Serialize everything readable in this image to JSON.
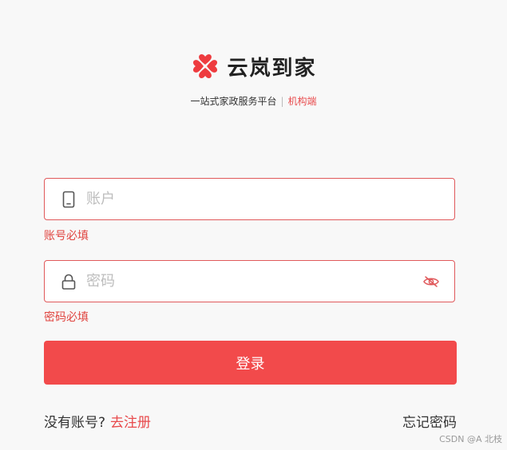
{
  "brand": {
    "name": "云岚到家",
    "logo_icon": "clover-heart-logo",
    "accent_color": "#f24a4b"
  },
  "tagline": {
    "text": "一站式家政服务平台",
    "separator": "|",
    "role": "机构端"
  },
  "form": {
    "account": {
      "icon": "phone-icon",
      "placeholder": "账户",
      "value": "",
      "error": "账号必填"
    },
    "password": {
      "icon": "lock-icon",
      "placeholder": "密码",
      "value": "",
      "error": "密码必填",
      "toggle_icon": "eye-off-icon"
    },
    "login_label": "登录"
  },
  "footer": {
    "no_account_text": "没有账号?",
    "register_link": "去注册",
    "forgot_password": "忘记密码"
  },
  "watermark": "CSDN @A 北枝"
}
